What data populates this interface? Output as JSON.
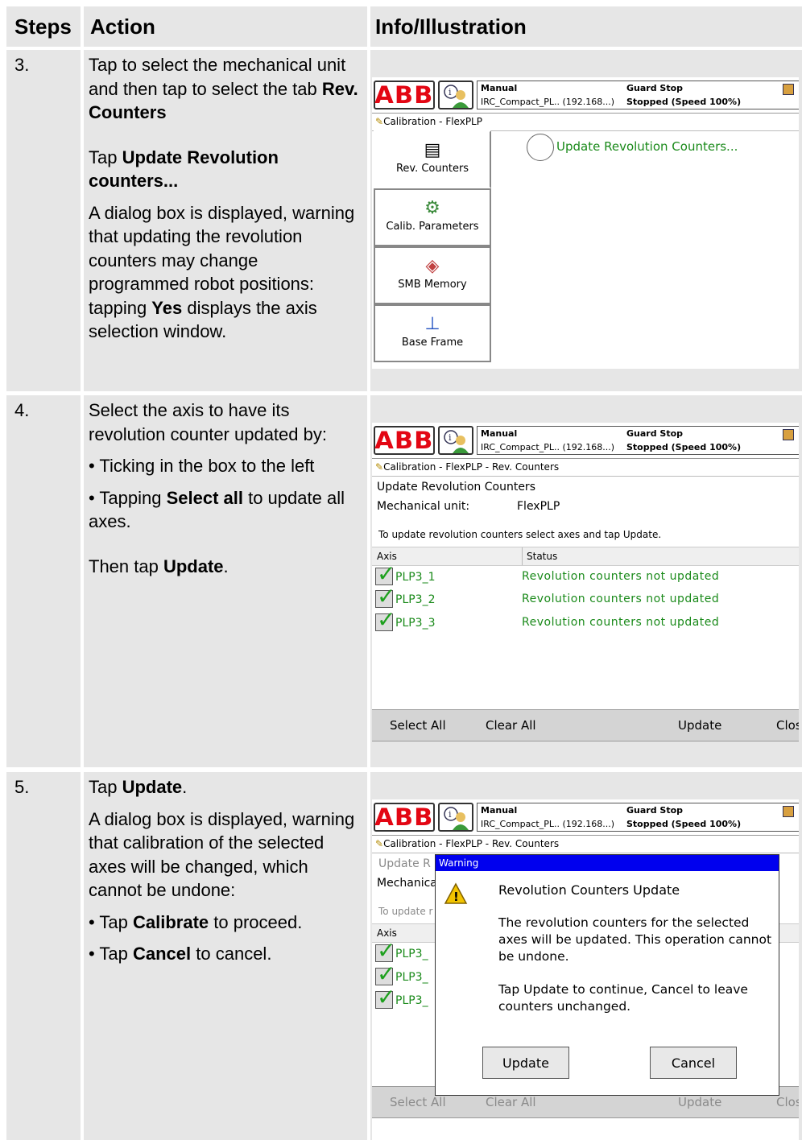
{
  "header": {
    "steps": "Steps",
    "action": "Action",
    "info": "Info/Illustration"
  },
  "rows": [
    {
      "step": "3.",
      "action": {
        "p1_pre": "Tap to select the mechanical unit and then tap to select the tab ",
        "p1_bold": "Rev. Counters",
        "p2_pre": "Tap ",
        "p2_bold": "Update Revolution counters...",
        "p3_pre": "A dialog box is displayed, warning that updating the revolution counters may change programmed robot positions: tapping ",
        "p3_bold": "Yes",
        "p3_post": " displays the axis selection window."
      },
      "screen": {
        "breadcrumb": "Calibration - FlexPLP",
        "tiles": [
          "Rev. Counters",
          "Calib. Parameters",
          "SMB Memory",
          "Base Frame"
        ],
        "link": "Update Revolution Counters..."
      }
    },
    {
      "step": "4.",
      "action": {
        "p1": "Select the axis to have its revolution counter updated by:",
        "b1": "• Ticking in the box to the left",
        "b2_pre": "• Tapping ",
        "b2_bold": "Select all",
        "b2_post": " to update all axes.",
        "p2_pre": "Then tap ",
        "p2_bold": "Update",
        "p2_post": "."
      },
      "screen": {
        "breadcrumb": "Calibration - FlexPLP - Rev. Counters",
        "title": "Update Revolution Counters",
        "mech_label": "Mechanical unit:",
        "mech_value": "FlexPLP",
        "instruction": "To update revolution counters select axes and tap Update.",
        "col_axis": "Axis",
        "col_status": "Status",
        "axes": [
          {
            "name": "PLP3_1",
            "status": "Revolution counters not updated"
          },
          {
            "name": "PLP3_2",
            "status": "Revolution counters not updated"
          },
          {
            "name": "PLP3_3",
            "status": "Revolution counters not updated"
          }
        ],
        "buttons": [
          "Select All",
          "Clear All",
          "Update",
          "Clos"
        ]
      }
    },
    {
      "step": "5.",
      "action": {
        "p1_pre": "Tap ",
        "p1_bold": "Update",
        "p1_post": ".",
        "p2": "A dialog box is displayed, warning that calibration of the selected axes will be changed, which cannot be undone:",
        "b1_pre": "• Tap ",
        "b1_bold": "Calibrate",
        "b1_post": " to proceed.",
        "b2_pre": "• Tap ",
        "b2_bold": "Cancel",
        "b2_post": " to cancel."
      },
      "screen": {
        "breadcrumb": "Calibration - FlexPLP - Rev. Counters",
        "bg_title": "Update R",
        "bg_mech": "Mechanica",
        "bg_instr": "To update r",
        "col_axis": "Axis",
        "bg_axes": [
          "PLP3_",
          "PLP3_",
          "PLP3_"
        ],
        "dialog_title": "Warning",
        "dialog_heading": "Revolution Counters Update",
        "dialog_body1": "The revolution counters for the selected axes will be updated. This operation cannot be undone.",
        "dialog_body2": "Tap Update to continue, Cancel to leave counters unchanged.",
        "dialog_ok": "Update",
        "dialog_cancel": "Cancel",
        "buttons": [
          "Select All",
          "Clear All",
          "Update",
          "Clos"
        ]
      }
    }
  ],
  "statusbar": {
    "mode": "Manual",
    "controller": "IRC_Compact_PL.. (192.168...)",
    "state": "Guard Stop",
    "speed": "Stopped (Speed 100%)"
  },
  "logo": "ABB",
  "colors": {
    "cell_bg": "#e6e6e6",
    "status_green": "#1a8a1a",
    "abb_red": "#e30613",
    "dialog_title": "#0000ee"
  }
}
